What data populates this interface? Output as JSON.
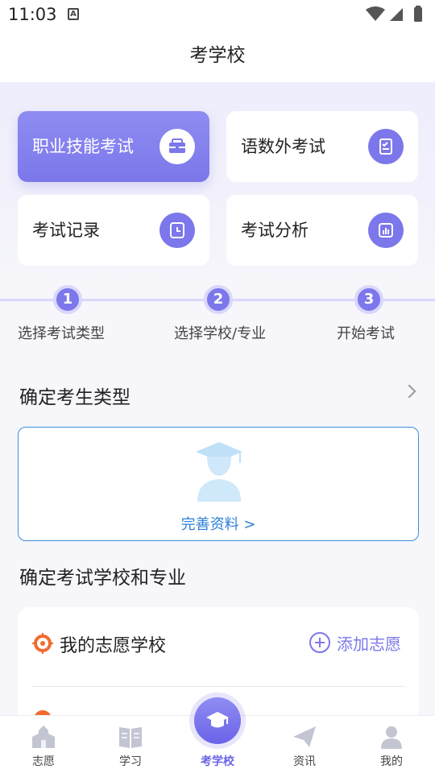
{
  "status_bar": {
    "time": "11:03",
    "badge": "A"
  },
  "header": {
    "title": "考学校"
  },
  "cards": [
    {
      "label": "职业技能考试",
      "icon": "briefcase-icon"
    },
    {
      "label": "语数外考试",
      "icon": "checklist-icon"
    },
    {
      "label": "考试记录",
      "icon": "clock-icon"
    },
    {
      "label": "考试分析",
      "icon": "bar-chart-icon"
    }
  ],
  "steps": [
    {
      "number": "1",
      "label": "选择考试类型"
    },
    {
      "number": "2",
      "label": "选择学校/专业"
    },
    {
      "number": "3",
      "label": "开始考试"
    }
  ],
  "student_type": {
    "title": "确定考生类型",
    "link": "完善资料 >"
  },
  "school_major": {
    "title": "确定考试学校和专业",
    "wish_school_label": "我的志愿学校",
    "add_wish_label": "添加志愿"
  },
  "tabbar": [
    {
      "label": "志愿",
      "icon": "school-building-icon"
    },
    {
      "label": "学习",
      "icon": "book-icon"
    },
    {
      "label": "考学校",
      "icon": "graduation-cap-icon"
    },
    {
      "label": "资讯",
      "icon": "paper-plane-icon"
    },
    {
      "label": "我的",
      "icon": "person-icon"
    }
  ],
  "colors": {
    "accent": "#7c77ea",
    "link_blue": "#2d7fd6",
    "target_orange": "#f26a2e"
  }
}
